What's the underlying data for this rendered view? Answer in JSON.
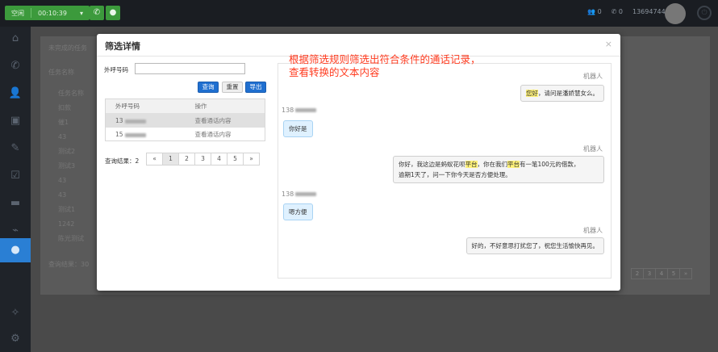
{
  "topbar": {
    "status": "空闲",
    "timer": "00:10:39",
    "user_id": "13694744630"
  },
  "bg": {
    "tab": "未完成的任务",
    "task_label": "任务名称",
    "rows": [
      "任务名称",
      "扣款",
      "催1",
      "43",
      "测试2",
      "测试3",
      "43",
      "43",
      "测试1",
      "1242",
      "陈光测试"
    ],
    "result": "查询结果：30",
    "pager": [
      "2",
      "3",
      "4",
      "5",
      "»"
    ]
  },
  "modal": {
    "title": "筛选详情",
    "close": "×"
  },
  "filter": {
    "label": "外呼号码",
    "value": "",
    "btn_query": "查询",
    "btn_reset": "重置",
    "btn_export": "导出"
  },
  "table": {
    "headers": [
      "外呼号码",
      "操作"
    ],
    "rows": [
      {
        "number": "13",
        "action": "查看通话内容"
      },
      {
        "number": "15",
        "action": "查看通话内容"
      }
    ]
  },
  "pagination": {
    "result": "查询结果：2",
    "prev": "«",
    "pages": [
      "1",
      "2",
      "3",
      "4",
      "5"
    ],
    "next": "»"
  },
  "chat": {
    "bot_label": "机器人",
    "cust_label": "138",
    "messages": [
      {
        "role": "bot",
        "pre": "",
        "hl": "您好",
        "post": "，请问是潘娇慧女么。"
      },
      {
        "role": "cust",
        "text": "你好是"
      },
      {
        "role": "bot",
        "t1": "你好，我这边是蚂蚁花呗",
        "h1": "平台",
        "t2": "，你在我们",
        "h2": "平台",
        "t3": "有一笔100元的借款，",
        "t4": "逾期1天了，问一下你今天是否方便处理。"
      },
      {
        "role": "cust",
        "text": "嗯方便"
      },
      {
        "role": "bot",
        "text": "好的，不好意思打扰您了，祝您生活愉快再见。"
      }
    ]
  },
  "annotation": {
    "line1": "根据筛选规则筛选出符合条件的通话记录，",
    "line2": "查看转换的文本内容"
  },
  "colors": {
    "primary": "#1f6fd0",
    "annotation": "#ff3b1f",
    "status_green": "#3c9a3c",
    "highlight": "#fff27a"
  }
}
